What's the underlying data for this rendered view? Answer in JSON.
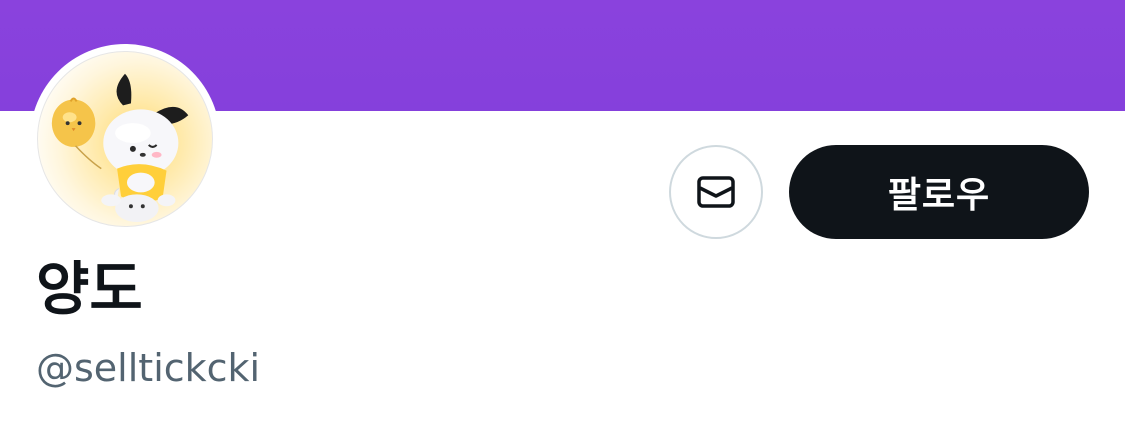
{
  "banner": {
    "color": "#8a42dd"
  },
  "profile": {
    "avatar_icon": "pochacco-avatar-image",
    "display_name": "양도",
    "handle": "@selltickcki"
  },
  "actions": {
    "message_icon": "envelope-icon",
    "follow_label": "팔로우"
  },
  "colors": {
    "follow_bg": "#0f1419",
    "follow_text": "#ffffff",
    "handle_text": "#536471",
    "border": "#cfd9de"
  }
}
